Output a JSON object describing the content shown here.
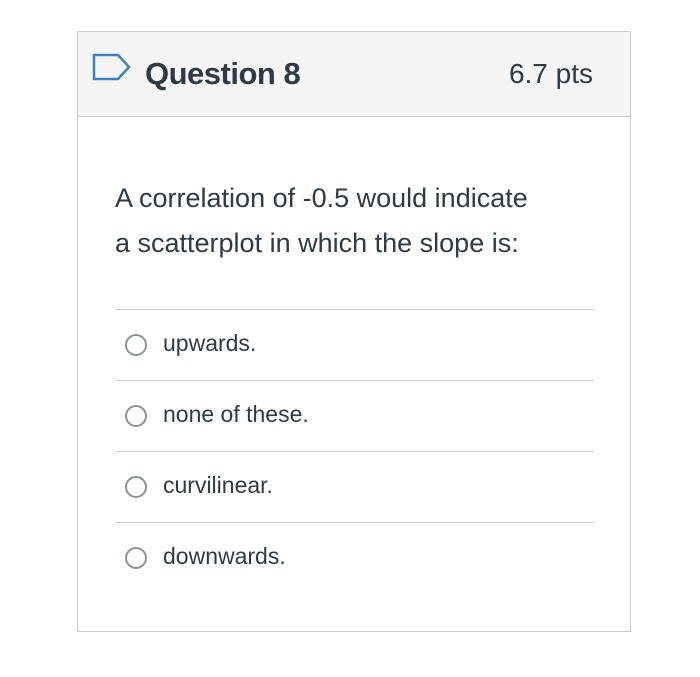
{
  "question": {
    "flag_icon": "flag-outline-icon",
    "title": "Question 8",
    "points": "6.7 pts",
    "prompt_line1": "A correlation of -0.5 would indicate",
    "prompt_line2": "a scatterplot in which the slope is:"
  },
  "answers": [
    {
      "label": "upwards.",
      "selected": false
    },
    {
      "label": "none of these.",
      "selected": false
    },
    {
      "label": "curvilinear.",
      "selected": false
    },
    {
      "label": "downwards.",
      "selected": false
    }
  ],
  "colors": {
    "text": "#2d3b45",
    "border": "#c7cdd1",
    "header_bg": "#f5f5f5",
    "flag_stroke": "#3b82c4"
  }
}
